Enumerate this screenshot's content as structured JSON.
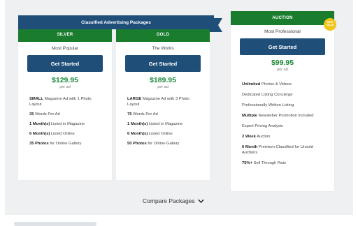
{
  "banner": {
    "title": "Classified Advertising Packages"
  },
  "silver": {
    "title": "SILVER",
    "subtitle": "Most Popular",
    "button": "Get Started",
    "price": "$129.95",
    "per": "per ad",
    "features": [
      {
        "bold": "SMALL",
        "text": "  Magazine Ad with 1 Photo Layout"
      },
      {
        "bold": "35",
        "text": "  Words Per Ad"
      },
      {
        "bold": "1 Month(s)",
        "text": "  Listed in Magazine"
      },
      {
        "bold": "6 Month(s)",
        "text": "  Listed Online"
      },
      {
        "bold": "35 Photos",
        "text": "  for Online Gallery"
      }
    ]
  },
  "gold": {
    "title": "GOLD",
    "subtitle": "The Works",
    "button": "Get Started",
    "price": "$189.95",
    "per": "per ad",
    "features": [
      {
        "bold": "LARGE",
        "text": "  Magazine Ad with 3 Photo Layout"
      },
      {
        "bold": "75",
        "text": "  Words Per Ad"
      },
      {
        "bold": "1 Month(s)",
        "text": "  Listed in Magazine"
      },
      {
        "bold": "6 Month(s)",
        "text": "  Listed Online"
      },
      {
        "bold": "50 Photos",
        "text": "  for Online Gallery"
      }
    ]
  },
  "auction": {
    "title": "AUCTION",
    "subtitle": "Most Professional",
    "button": "Get Started",
    "price": "$99.95",
    "per": "per ad",
    "badge": "BEST VALUE",
    "features": [
      {
        "bold": "Unlimited",
        "text": " Photos & Videos"
      },
      {
        "bold": "",
        "text": "Dedicated Listing Concierge"
      },
      {
        "bold": "",
        "text": "Professionally Written Listing"
      },
      {
        "bold": "Multiple",
        "text": " Newsletter Promotion Included"
      },
      {
        "bold": "",
        "text": "Expert Pricing Analysis"
      },
      {
        "bold": "2 Week",
        "text": " Auction"
      },
      {
        "bold": "6 Month",
        "text": " Premium Classified for Unsold Auctions"
      },
      {
        "bold": "75%+",
        "text": " Sell Through Rate"
      }
    ]
  },
  "compare": {
    "label": "Compare Packages"
  },
  "colors": {
    "navy": "#1f4e79",
    "green": "#1a7d2e",
    "price_green": "#1a8a3a",
    "gold_badge": "#f0c419"
  }
}
